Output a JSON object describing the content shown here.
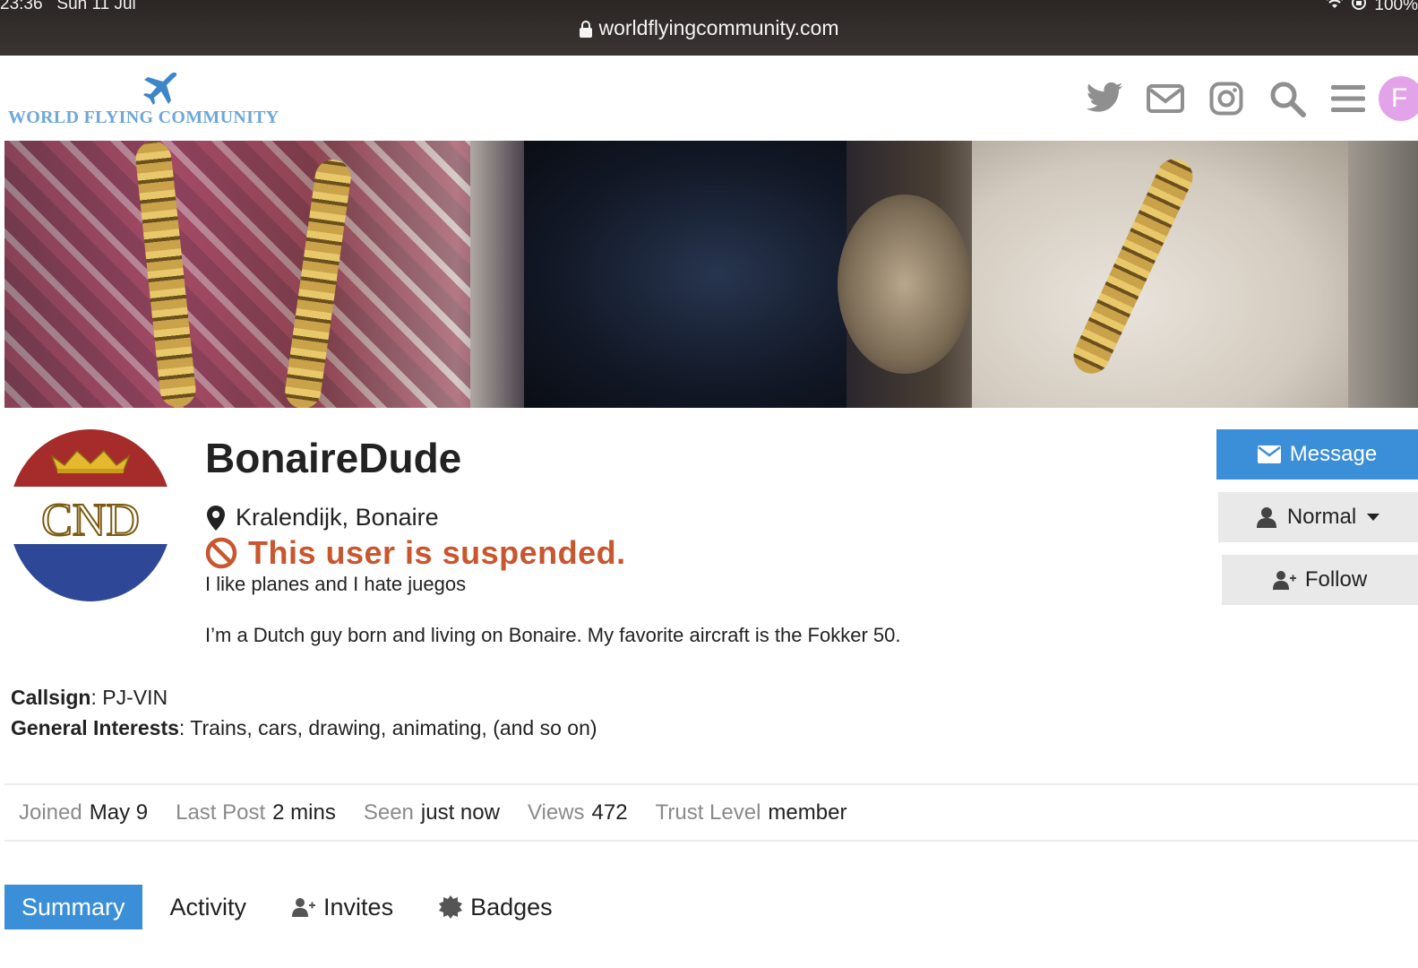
{
  "statusbar": {
    "time": "23:36",
    "date": "Sun 11 Jul",
    "battery": "100%",
    "url": "worldflyingcommunity.com"
  },
  "site": {
    "logo_text": "WORLD FLYING COMMUNITY",
    "avatar_letter": "F",
    "accent_color": "#3b8fd8"
  },
  "header_icons": [
    "twitter-icon",
    "mail-icon",
    "instagram-icon",
    "search-icon",
    "hamburger-menu-icon"
  ],
  "profile": {
    "username": "BonaireDude",
    "location": "Kralendijk, Bonaire",
    "suspended_text": "This user is suspended.",
    "tagline": "I like planes and I hate juegos",
    "bio": "I’m a Dutch guy born and living on Bonaire. My favorite aircraft is the Fokker 50.",
    "avatar_monogram": "CND"
  },
  "actions": {
    "message": "Message",
    "notification_level": "Normal",
    "follow": "Follow"
  },
  "fields": [
    {
      "label": "Callsign",
      "value": "PJ-VIN"
    },
    {
      "label": "General Interests",
      "value": "Trains, cars, drawing, animating, (and so on)"
    }
  ],
  "stats": [
    {
      "label": "Joined",
      "value": "May 9"
    },
    {
      "label": "Last Post",
      "value": "2 mins"
    },
    {
      "label": "Seen",
      "value": "just now"
    },
    {
      "label": "Views",
      "value": "472"
    },
    {
      "label": "Trust Level",
      "value": "member"
    }
  ],
  "tabs": [
    {
      "label": "Summary",
      "active": true
    },
    {
      "label": "Activity",
      "active": false
    },
    {
      "label": "Invites",
      "active": false
    },
    {
      "label": "Badges",
      "active": false
    }
  ]
}
